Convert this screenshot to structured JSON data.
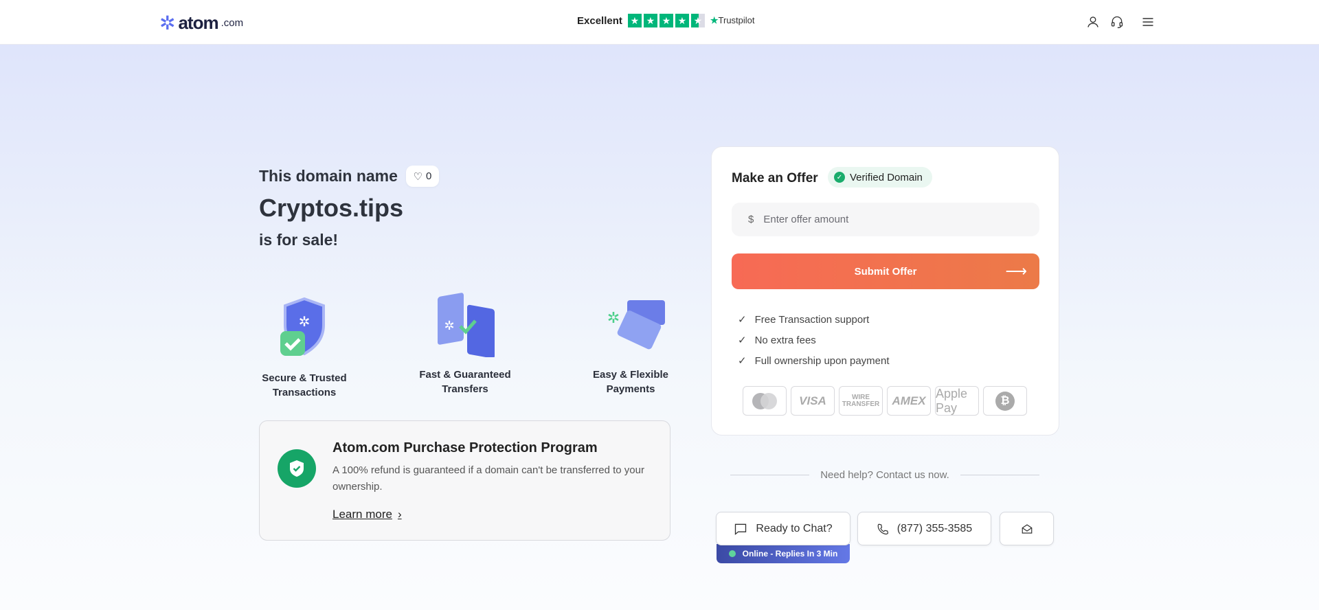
{
  "header": {
    "logo": {
      "word": "atom",
      "suffix": ".com"
    },
    "trustpilot": {
      "rating_label": "Excellent",
      "stars": 4.5,
      "brand": "Trustpilot",
      "color": "#00b67a"
    },
    "icons": [
      "user-icon",
      "headset-icon",
      "menu-icon"
    ]
  },
  "hero": {
    "line1": "This domain name",
    "likes": "0",
    "domain": "Cryptos.tips",
    "line3": "is for sale!"
  },
  "features": [
    {
      "label1": "Secure & Trusted",
      "label2": "Transactions",
      "icon": "shield-check-icon"
    },
    {
      "label1": "Fast & Guaranteed",
      "label2": "Transfers",
      "icon": "browser-transfer-icon"
    },
    {
      "label1": "Easy & Flexible",
      "label2": "Payments",
      "icon": "cards-icon"
    }
  ],
  "protection": {
    "title": "Atom.com Purchase Protection Program",
    "description": "A 100% refund is guaranteed if a domain can't be transferred to your ownership.",
    "link": "Learn more"
  },
  "offer": {
    "title": "Make an Offer",
    "badge": "Verified Domain",
    "currency": "$",
    "placeholder": "Enter offer amount",
    "submit": "Submit Offer",
    "accent": "#f76a55",
    "benefits": [
      "Free Transaction support",
      "No extra fees",
      "Full ownership upon payment"
    ],
    "payments": [
      "Mastercard",
      "VISA",
      "WIRE TRANSFER",
      "AMEX",
      "Apple Pay",
      "Bitcoin"
    ]
  },
  "contact": {
    "help": "Need help? Contact us now.",
    "chat": "Ready to Chat?",
    "phone": "(877) 355-3585",
    "status": "Online - Replies In 3 Min"
  }
}
